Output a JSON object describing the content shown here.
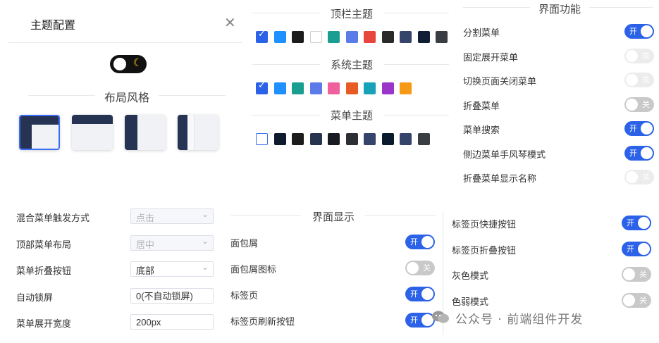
{
  "panel": {
    "title": "主题配置",
    "close": "✕"
  },
  "dark_mode": {
    "moon": "☾"
  },
  "layout": {
    "title": "布局风格"
  },
  "header_theme": {
    "title": "顶栏主题",
    "colors": [
      "#2b62e8",
      "#1e90ff",
      "#1c1c1c",
      "#ffffff",
      "#1a9e8f",
      "#5b7be8",
      "#e8453c",
      "#2a2a2a",
      "#34446b",
      "#101e35",
      "#3a3d42"
    ],
    "check": "✓"
  },
  "system_theme": {
    "title": "系统主题",
    "colors": [
      "#2b62e8",
      "#1e90ff",
      "#1a9e8f",
      "#5b7be8",
      "#f0609c",
      "#e85b24",
      "#17a2b8",
      "#9b35c9",
      "#f59a16"
    ],
    "check": "✓"
  },
  "menu_theme": {
    "title": "菜单主题",
    "colors": [
      "#ffffff",
      "#0f1a2e",
      "#1c1c1c",
      "#26344f",
      "#181c22",
      "#2e2e36",
      "#34446b",
      "#0b1b2e",
      "#34446b",
      "#3a3d42"
    ]
  },
  "interface_func": {
    "title": "界面功能",
    "items": [
      {
        "label": "分割菜单",
        "state": "on",
        "text": "开"
      },
      {
        "label": "固定展开菜单",
        "state": "dim",
        "text": "关"
      },
      {
        "label": "切换页面关闭菜单",
        "state": "dim",
        "text": "关"
      },
      {
        "label": "折叠菜单",
        "state": "off",
        "text": "关"
      },
      {
        "label": "菜单搜索",
        "state": "on",
        "text": "开"
      },
      {
        "label": "侧边菜单手风琴模式",
        "state": "on",
        "text": "开"
      },
      {
        "label": "折叠菜单显示名称",
        "state": "dim",
        "text": "关"
      }
    ]
  },
  "settings": {
    "items": [
      {
        "label": "混合菜单触发方式",
        "value": "点击",
        "kind": "select-disabled"
      },
      {
        "label": "顶部菜单布局",
        "value": "居中",
        "kind": "select-disabled"
      },
      {
        "label": "菜单折叠按钮",
        "value": "底部",
        "kind": "select"
      },
      {
        "label": "自动锁屏",
        "value": "0(不自动锁屏)",
        "kind": "input"
      },
      {
        "label": "菜单展开宽度",
        "value": "200px",
        "kind": "input"
      }
    ]
  },
  "display": {
    "title": "界面显示",
    "items": [
      {
        "label": "面包屑",
        "state": "on",
        "text": "开"
      },
      {
        "label": "面包屑图标",
        "state": "off",
        "text": "关"
      },
      {
        "label": "标签页",
        "state": "on",
        "text": "开"
      },
      {
        "label": "标签页刷新按钮",
        "state": "on",
        "text": "开"
      }
    ]
  },
  "right_display": {
    "items": [
      {
        "label": "标签页快捷按钮",
        "state": "on",
        "text": "开"
      },
      {
        "label": "标签页折叠按钮",
        "state": "on",
        "text": "开"
      },
      {
        "label": "灰色模式",
        "state": "off",
        "text": "关"
      },
      {
        "label": "色弱模式",
        "state": "off",
        "text": "关"
      }
    ]
  },
  "watermark": "公众号 · 前端组件开发"
}
